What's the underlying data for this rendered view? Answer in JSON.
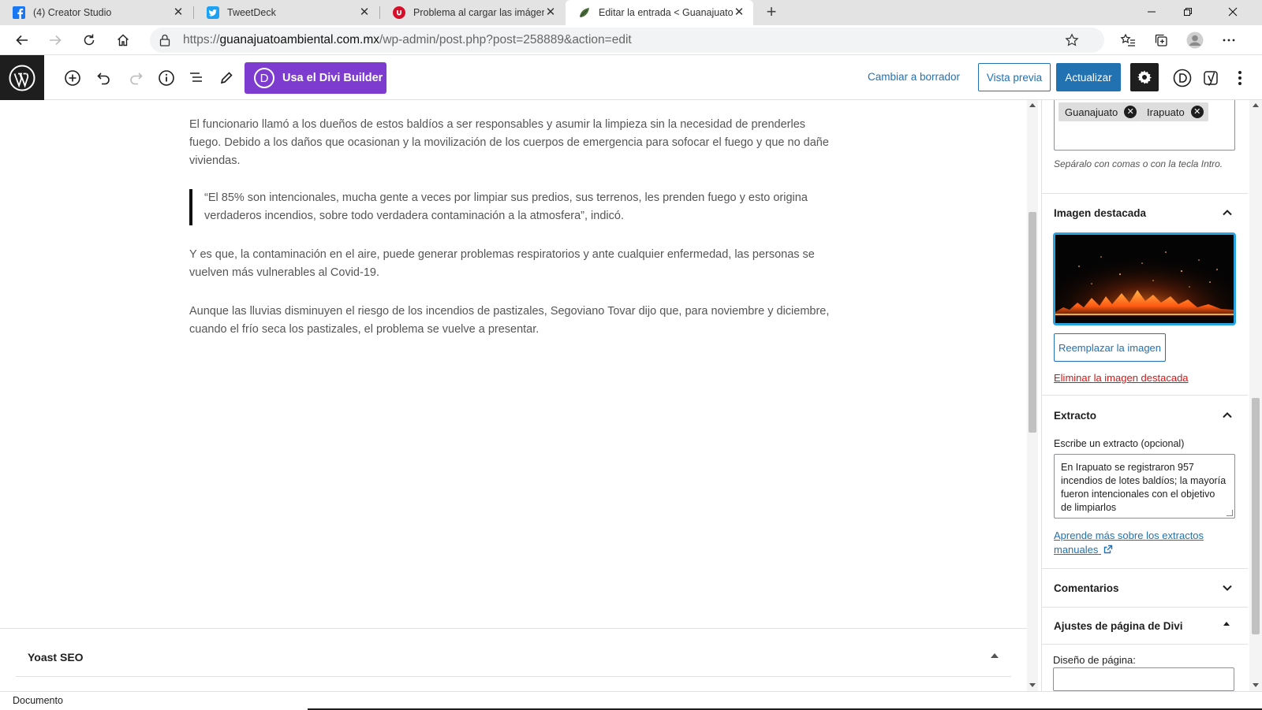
{
  "browser": {
    "tabs": [
      {
        "title": "(4) Creator Studio",
        "icon": "facebook-icon",
        "active": false
      },
      {
        "title": "TweetDeck",
        "icon": "twitter-icon",
        "active": false
      },
      {
        "title": "Problema al cargar las imágenes",
        "icon": "red-u-icon",
        "active": false
      },
      {
        "title": "Editar la entrada < Guanajuato A",
        "icon": "site-leaf-icon",
        "active": true
      }
    ],
    "close_glyph": "✕",
    "new_tab_glyph": "+",
    "url_prefix": "https://",
    "url_host": "guanajuatoambiental.com.mx",
    "url_path": "/wp-admin/post.php?post=258889&action=edit"
  },
  "editor_header": {
    "divi_button_label": "Usa el Divi Builder",
    "divi_letter": "D",
    "switch_to_draft": "Cambiar a borrador",
    "preview": "Vista previa",
    "update": "Actualizar"
  },
  "content": {
    "paragraphs": [
      "El funcionario llamó a los dueños de estos baldíos a ser responsables y asumir la limpieza sin la necesidad de prenderles fuego. Debido a los daños que ocasionan y la movilización de los cuerpos de emergencia para sofocar el fuego y que no dañe viviendas.",
      "Y es que, la contaminación en el aire, puede generar problemas respiratorios y ante cualquier enfermedad, las personas se vuelven más vulnerables al Covid-19.",
      "Aunque las lluvias disminuyen el riesgo de los incendios de pastizales, Segoviano Tovar dijo que, para noviembre y diciembre, cuando el frío seca los pastizales, el problema se vuelve a presentar."
    ],
    "quote": "“El 85% son intencionales, mucha gente a veces por limpiar sus predios, sus terrenos, les prenden fuego y esto origina verdaderos incendios, sobre todo verdadera contaminación a la atmosfera”, indicó."
  },
  "yoast": {
    "title": "Yoast SEO"
  },
  "sidebar": {
    "tags": [
      "Guanajuato",
      "Irapuato"
    ],
    "tag_hint": "Sepáralo con comas o con la tecla Intro.",
    "featured_image": {
      "title": "Imagen destacada",
      "replace": "Reemplazar la imagen",
      "remove": "Eliminar la imagen destacada"
    },
    "excerpt": {
      "title": "Extracto",
      "label": "Escribe un extracto (opcional)",
      "value": "En Irapuato se registraron 957 incendios de lotes baldíos; la mayoría fueron intencionales con el objetivo de limpiarlos",
      "learn_more": "Aprende más sobre los extractos manuales"
    },
    "comments": {
      "title": "Comentarios"
    },
    "divi_settings": {
      "title": "Ajustes de página de Divi",
      "layout_label": "Diseño de página:"
    }
  },
  "footer": {
    "breadcrumb": "Documento"
  },
  "colors": {
    "wp_blue": "#2271b1",
    "divi_purple": "#7e3bd0",
    "danger_red": "#cc1818",
    "featured_border": "#2aa4e0"
  }
}
